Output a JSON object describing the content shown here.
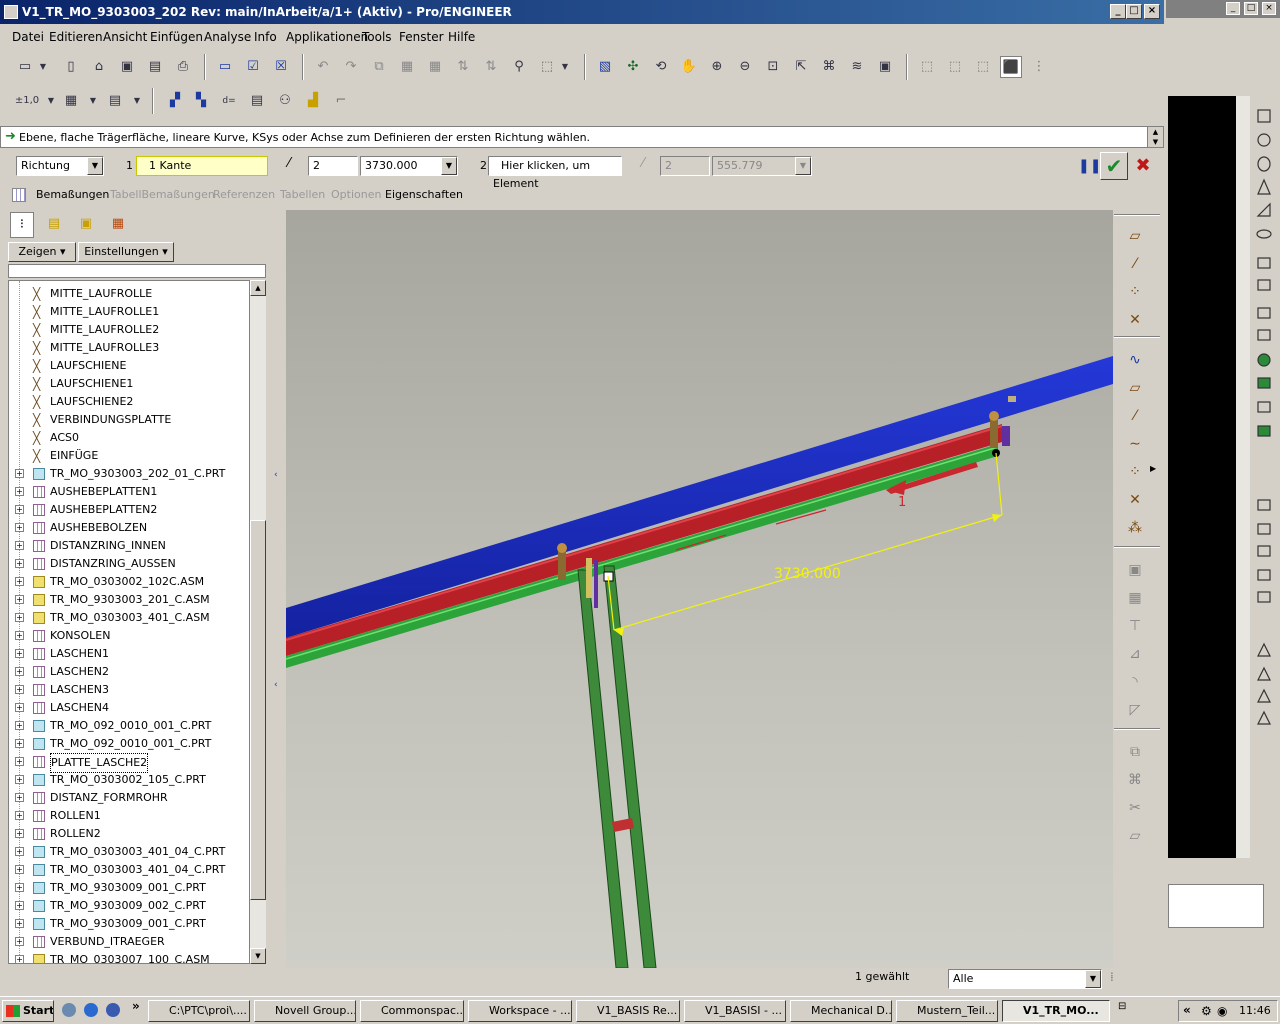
{
  "window": {
    "title": "V1_TR_MO_9303003_202 Rev: main/InArbeit/a/1+ (Aktiv) - Pro/ENGINEER"
  },
  "menu": [
    "Datei",
    "Editieren",
    "Ansicht",
    "Einfügen",
    "Analyse",
    "Info",
    "Applikationen",
    "Tools",
    "Fenster",
    "Hilfe"
  ],
  "message": "Ebene, flache Trägerfläche, lineare Kurve, KSys oder Achse zum Definieren der ersten Richtung wählen.",
  "dashboard": {
    "type": "Richtung",
    "dir1_num": "1",
    "dir1_ref": "1 Kante",
    "dir1_count": "2",
    "dir1_dist": "3730.000",
    "dir2_num": "2",
    "dir2_ref": "Hier klicken, um Element",
    "dir2_count": "2",
    "dir2_dist": "555.779"
  },
  "tabs": [
    "Bemaßungen",
    "TabellBemaßungen",
    "Referenzen",
    "Tabellen",
    "Optionen",
    "Eigenschaften"
  ],
  "nav": {
    "show_label": "Zeigen",
    "settings_label": "Einstellungen"
  },
  "tree": [
    {
      "label": "MITTE_LAUFROLLE",
      "kind": "datum"
    },
    {
      "label": "MITTE_LAUFROLLE1",
      "kind": "datum"
    },
    {
      "label": "MITTE_LAUFROLLE2",
      "kind": "datum"
    },
    {
      "label": "MITTE_LAUFROLLE3",
      "kind": "datum"
    },
    {
      "label": "LAUFSCHIENE",
      "kind": "datum"
    },
    {
      "label": "LAUFSCHIENE1",
      "kind": "datum"
    },
    {
      "label": "LAUFSCHIENE2",
      "kind": "datum"
    },
    {
      "label": "VERBINDUNGSPLATTE",
      "kind": "datum"
    },
    {
      "label": "ACS0",
      "kind": "datum"
    },
    {
      "label": "EINFÜGE",
      "kind": "datum"
    },
    {
      "label": "TR_MO_9303003_202_01_C.PRT",
      "kind": "part"
    },
    {
      "label": "AUSHEBEPLATTEN1",
      "kind": "pattern"
    },
    {
      "label": "AUSHEBEPLATTEN2",
      "kind": "pattern"
    },
    {
      "label": "AUSHEBEBOLZEN",
      "kind": "pattern"
    },
    {
      "label": "DISTANZRING_INNEN",
      "kind": "pattern"
    },
    {
      "label": "DISTANZRING_AUSSEN",
      "kind": "pattern"
    },
    {
      "label": "TR_MO_0303002_102C.ASM",
      "kind": "asm"
    },
    {
      "label": "TR_MO_9303003_201_C.ASM",
      "kind": "asm"
    },
    {
      "label": "TR_MO_0303003_401_C.ASM",
      "kind": "asm"
    },
    {
      "label": "KONSOLEN",
      "kind": "pattern"
    },
    {
      "label": "LASCHEN1",
      "kind": "pattern"
    },
    {
      "label": "LASCHEN2",
      "kind": "pattern"
    },
    {
      "label": "LASCHEN3",
      "kind": "pattern"
    },
    {
      "label": "LASCHEN4",
      "kind": "pattern"
    },
    {
      "label": "TR_MO_092_0010_001_C.PRT",
      "kind": "part"
    },
    {
      "label": "TR_MO_092_0010_001_C.PRT",
      "kind": "part"
    },
    {
      "label": "PLATTE_LASCHE2",
      "kind": "pattern"
    },
    {
      "label": "TR_MO_0303002_105_C.PRT",
      "kind": "part"
    },
    {
      "label": "DISTANZ_FORMROHR",
      "kind": "pattern"
    },
    {
      "label": "ROLLEN1",
      "kind": "pattern"
    },
    {
      "label": "ROLLEN2",
      "kind": "pattern"
    },
    {
      "label": "TR_MO_0303003_401_04_C.PRT",
      "kind": "part"
    },
    {
      "label": "TR_MO_0303003_401_04_C.PRT",
      "kind": "part"
    },
    {
      "label": "TR_MO_9303009_001_C.PRT",
      "kind": "part"
    },
    {
      "label": "TR_MO_9303009_002_C.PRT",
      "kind": "part"
    },
    {
      "label": "TR_MO_9303009_001_C.PRT",
      "kind": "part"
    },
    {
      "label": "VERBUND_ITRAEGER",
      "kind": "pattern"
    },
    {
      "label": "TR_MO_0303007_100_C.ASM",
      "kind": "asm"
    }
  ],
  "viewport": {
    "dimension": "3730.000",
    "direction_label": "1"
  },
  "status": {
    "selected": "1 gewählt",
    "filter": "Alle"
  },
  "taskbar": {
    "start": "Start",
    "tasks": [
      "C:\\PTC\\proi\\....",
      "Novell Group...",
      "Commonspac...",
      "Workspace - ...",
      "V1_BASIS Re...",
      "V1_BASISI - ...",
      "Mechanical D...",
      "Mustern_Teil...",
      "V1_TR_MO..."
    ],
    "clock": "11:46"
  },
  "colors": {
    "title_start": "#0a246a",
    "title_end": "#3a6ea5",
    "beam_blue": "#1c2ec8",
    "beam_red": "#c0242a",
    "beam_green": "#34b83e",
    "dim_yellow": "#f2f20a"
  }
}
